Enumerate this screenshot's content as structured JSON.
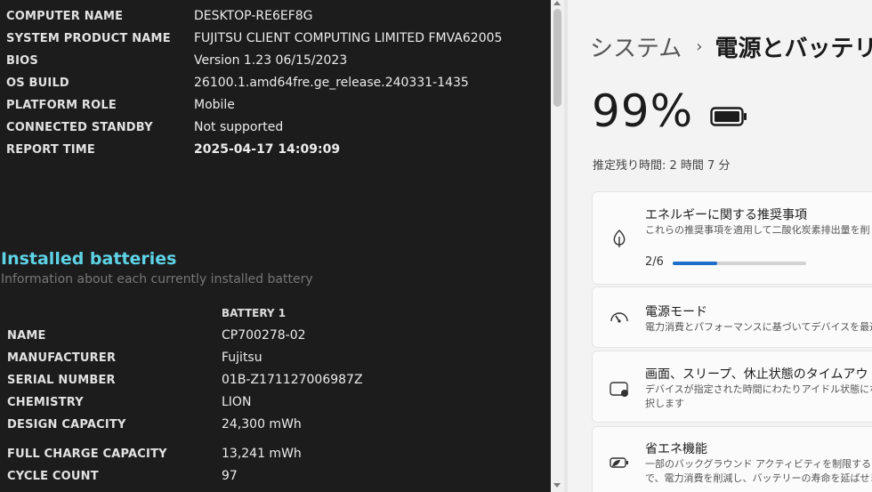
{
  "report": {
    "system_info": [
      {
        "key": "COMPUTER NAME",
        "value": "DESKTOP-RE6EF8G"
      },
      {
        "key": "SYSTEM PRODUCT NAME",
        "value": "FUJITSU CLIENT COMPUTING LIMITED FMVA62005"
      },
      {
        "key": "BIOS",
        "value": "Version 1.23 06/15/2023"
      },
      {
        "key": "OS BUILD",
        "value": "26100.1.amd64fre.ge_release.240331-1435"
      },
      {
        "key": "PLATFORM ROLE",
        "value": "Mobile"
      },
      {
        "key": "CONNECTED STANDBY",
        "value": "Not supported"
      },
      {
        "key": "REPORT TIME",
        "value": "2025-04-17  14:09:09"
      }
    ],
    "batteries_title": "Installed batteries",
    "batteries_subtitle": "Information about each currently installed battery",
    "battery_header": "BATTERY 1",
    "battery_rows": [
      {
        "key": "NAME",
        "value": "CP700278-02"
      },
      {
        "key": "MANUFACTURER",
        "value": "Fujitsu"
      },
      {
        "key": "SERIAL NUMBER",
        "value": "01B-Z171127006987Z"
      },
      {
        "key": "CHEMISTRY",
        "value": "LION"
      },
      {
        "key": "DESIGN CAPACITY",
        "value": "24,300 mWh"
      },
      {
        "key": "FULL CHARGE CAPACITY",
        "value": "13,241 mWh"
      },
      {
        "key": "CYCLE COUNT",
        "value": "97"
      }
    ]
  },
  "settings": {
    "breadcrumb_parent": "システム",
    "breadcrumb_sep": "›",
    "breadcrumb_current": "電源とバッテリー",
    "battery_percent": "99%",
    "remaining": "推定残り時間: 2 時間 7 分",
    "cards": [
      {
        "title": "エネルギーに関する推奨事項",
        "desc": "これらの推奨事項を適用して二酸化炭素排出量を削",
        "progress_label": "2/6",
        "progress_fraction": 0.333,
        "icon": "leaf-icon"
      },
      {
        "title": "電源モード",
        "desc": "電力消費とパフォーマンスに基づいてデバイスを最適化",
        "icon": "gauge-icon"
      },
      {
        "title": "画面、スリープ、休止状態のタイムアウト",
        "desc": "デバイスが指定された時間にわたりアイドル状態になっ",
        "desc2": "択します",
        "icon": "screen-sleep-icon"
      },
      {
        "title": "省エネ機能",
        "desc": "一部のバックグラウンド アクティビティを制限すること",
        "desc2": "で、電力消費を削減し、バッテリーの寿命を延ばせま",
        "icon": "battery-saver-icon"
      }
    ],
    "accent": "#1e6fc8"
  }
}
